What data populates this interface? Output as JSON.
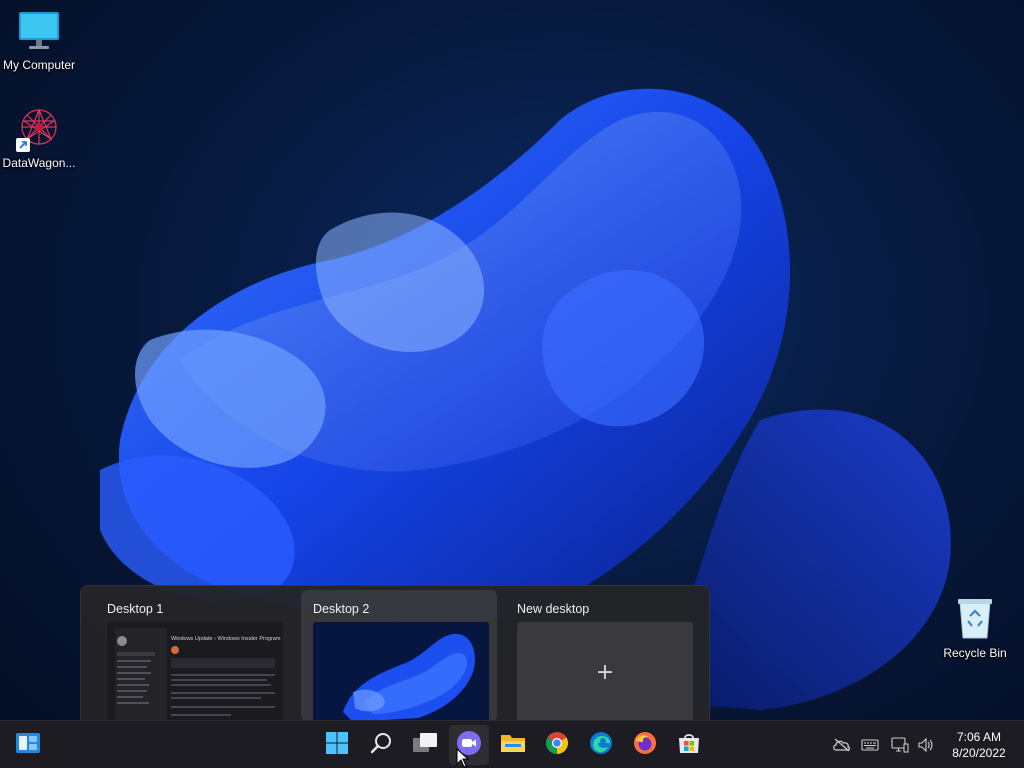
{
  "desktop": {
    "icons": [
      {
        "label": "My Computer"
      },
      {
        "label": "DataWagon..."
      },
      {
        "label": "Recycle Bin"
      }
    ]
  },
  "desktops_flyout": {
    "items": [
      {
        "title": "Desktop 1",
        "active": false
      },
      {
        "title": "Desktop 2",
        "active": true
      },
      {
        "title": "New desktop",
        "action": "+"
      }
    ],
    "thumbnail_text": {
      "header": "Windows Update  ›  Windows Insider Program"
    }
  },
  "taskbar": {
    "pinned": [
      {
        "icon": "widgets-icon"
      },
      {
        "icon": "start-windows-icon"
      },
      {
        "icon": "search-icon"
      },
      {
        "icon": "task-view-icon"
      },
      {
        "icon": "teams-chat-icon"
      },
      {
        "icon": "file-explorer-icon"
      },
      {
        "icon": "chrome-icon"
      },
      {
        "icon": "edge-icon"
      },
      {
        "icon": "firefox-icon"
      },
      {
        "icon": "microsoft-store-icon"
      }
    ],
    "tray": [
      {
        "icon": "onedrive-offline-icon"
      },
      {
        "icon": "keyboard-icon"
      },
      {
        "icon": "network-icon"
      },
      {
        "icon": "volume-icon"
      }
    ],
    "clock": {
      "time": "7:06 AM",
      "date": "8/20/2022"
    }
  },
  "colors": {
    "accent": "#1e5cff",
    "taskbar": "#1c1c22",
    "flyout": "#242428"
  }
}
